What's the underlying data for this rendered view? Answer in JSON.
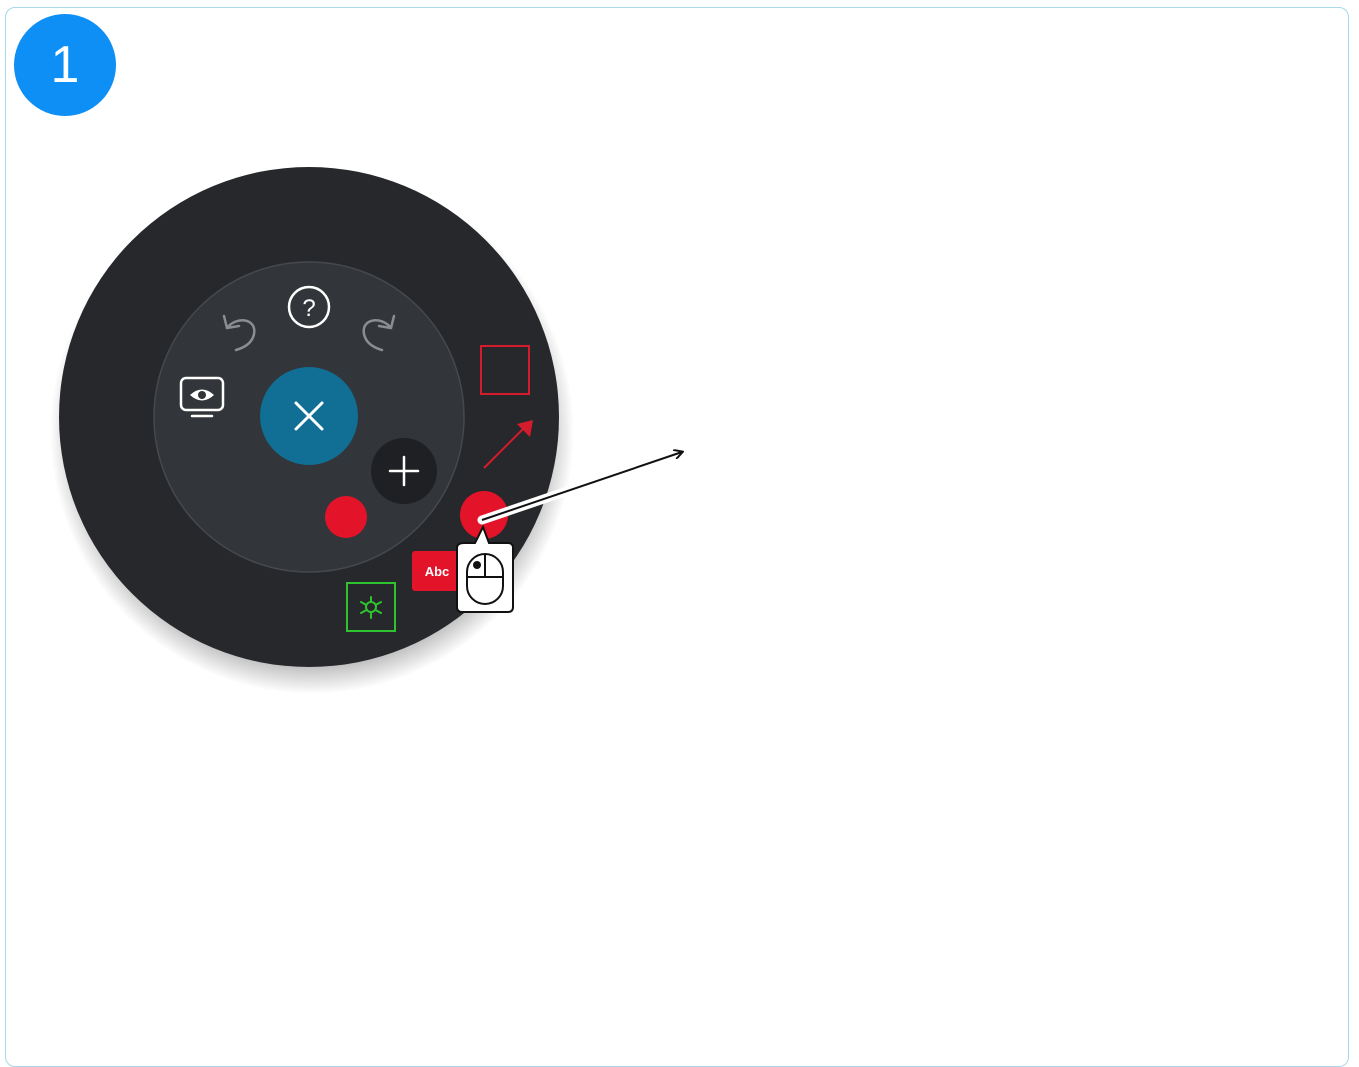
{
  "step": {
    "number": "1"
  },
  "radial_menu": {
    "center_button": {
      "icon": "close-icon"
    },
    "inner_tools": [
      {
        "icon": "help-icon"
      },
      {
        "icon": "undo-icon"
      },
      {
        "icon": "redo-icon"
      },
      {
        "icon": "eye-monitor-icon"
      },
      {
        "icon": "plus-icon"
      }
    ],
    "outer_tools": [
      {
        "icon": "rectangle-icon",
        "color": "#d51b2c"
      },
      {
        "icon": "arrow-icon",
        "color": "#d51b2c"
      },
      {
        "icon": "record-icon",
        "color": "#e3142a"
      },
      {
        "icon": "text-icon",
        "label": "Abc",
        "color": "#e3142a"
      },
      {
        "icon": "asterisk-icon",
        "color": "#2fc42f"
      }
    ],
    "colors": {
      "outer_ring": "#26282b",
      "inner_ring": "#323539",
      "center": "#116e94",
      "accent_red": "#e3142a"
    }
  },
  "instruction": {
    "icon": "mouse-left-click-icon"
  }
}
